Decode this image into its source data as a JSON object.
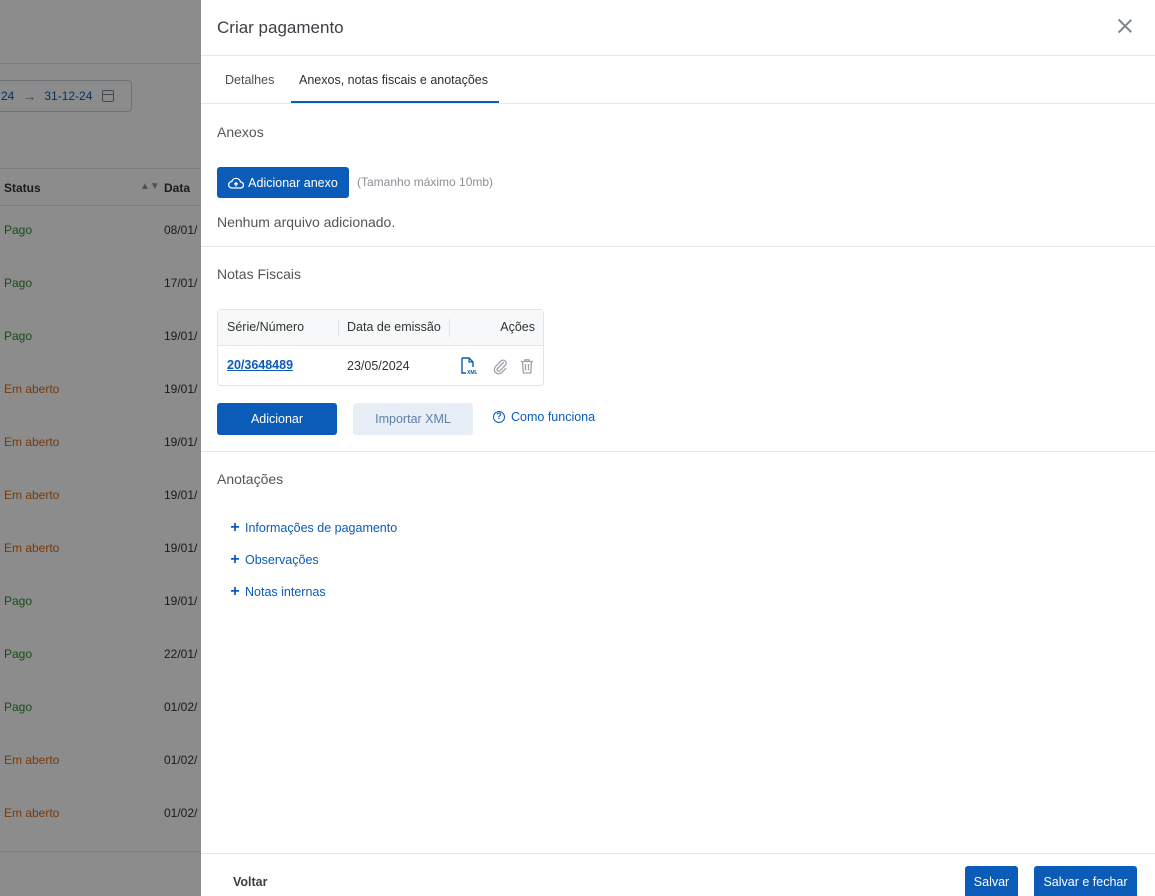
{
  "background": {
    "date_start": "24",
    "date_end": "31-12-24",
    "table": {
      "headers": {
        "status": "Status",
        "data": "Data"
      },
      "rows": [
        {
          "status": "Pago",
          "kind": "pago",
          "date": "08/01/"
        },
        {
          "status": "Pago",
          "kind": "pago",
          "date": "17/01/"
        },
        {
          "status": "Pago",
          "kind": "pago",
          "date": "19/01/"
        },
        {
          "status": "Em aberto",
          "kind": "aberto",
          "date": "19/01/"
        },
        {
          "status": "Em aberto",
          "kind": "aberto",
          "date": "19/01/"
        },
        {
          "status": "Em aberto",
          "kind": "aberto",
          "date": "19/01/"
        },
        {
          "status": "Em aberto",
          "kind": "aberto",
          "date": "19/01/"
        },
        {
          "status": "Pago",
          "kind": "pago",
          "date": "19/01/"
        },
        {
          "status": "Pago",
          "kind": "pago",
          "date": "22/01/"
        },
        {
          "status": "Pago",
          "kind": "pago",
          "date": "01/02/"
        },
        {
          "status": "Em aberto",
          "kind": "aberto",
          "date": "01/02/"
        },
        {
          "status": "Em aberto",
          "kind": "aberto",
          "date": "01/02/"
        }
      ]
    }
  },
  "drawer": {
    "title": "Criar pagamento",
    "tabs": [
      {
        "label": "Detalhes"
      },
      {
        "label": "Anexos, notas fiscais e anotações",
        "active": true
      }
    ],
    "anexos": {
      "title": "Anexos",
      "add_button": "Adicionar anexo",
      "hint": "(Tamanho máximo 10mb)",
      "empty": "Nenhum arquivo adicionado."
    },
    "notas_fiscais": {
      "title": "Notas Fiscais",
      "headers": {
        "serie": "Série/Número",
        "data": "Data de emissão",
        "acoes": "Ações"
      },
      "rows": [
        {
          "serie": "20/3648489",
          "data": "23/05/2024"
        }
      ],
      "add_button": "Adicionar",
      "import_button": "Importar XML",
      "help_link": "Como funciona"
    },
    "anotacoes": {
      "title": "Anotações",
      "items": [
        {
          "label": "Informações de pagamento"
        },
        {
          "label": "Observações"
        },
        {
          "label": "Notas internas"
        }
      ]
    },
    "footer": {
      "back": "Voltar",
      "save": "Salvar",
      "save_close": "Salvar e fechar"
    }
  },
  "colors": {
    "primary": "#0b5bb8",
    "pago": "#2f8a2f",
    "em_aberto": "#d66a16",
    "overlay": "rgba(0,0,0,0.45)"
  }
}
